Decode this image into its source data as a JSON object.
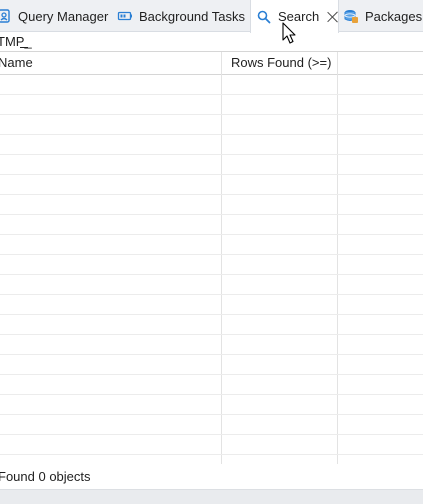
{
  "tabs": [
    {
      "label": "Query Manager",
      "icon": "query-manager-icon"
    },
    {
      "label": "Background Tasks",
      "icon": "background-tasks-icon"
    },
    {
      "label": "Search",
      "icon": "search-icon",
      "active": true
    },
    {
      "label": "Packages",
      "icon": "packages-icon"
    }
  ],
  "filter": {
    "value": "TMP_"
  },
  "table": {
    "columns": [
      "Name",
      "Rows Found (>=)"
    ],
    "rows": []
  },
  "status": {
    "text": "Found 0 objects"
  },
  "colors": {
    "accent": "#2a7fd4",
    "tab_bar": "#eef0f3",
    "grid_line": "#e3e3e3"
  }
}
